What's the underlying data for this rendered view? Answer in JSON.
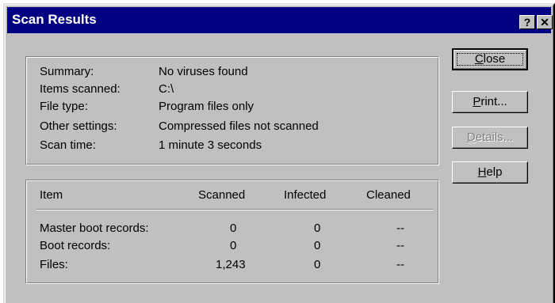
{
  "window": {
    "title": "Scan Results",
    "help_button": "?",
    "close_button": "✕"
  },
  "summary": {
    "rows": [
      {
        "label": "Summary:",
        "value": "No viruses found"
      },
      {
        "label": "Items scanned:",
        "value": "C:\\"
      },
      {
        "label": "File type:",
        "value": "Program files only"
      },
      {
        "label": "Other settings:",
        "value": "Compressed files not scanned"
      },
      {
        "label": "Scan time:",
        "value": "1 minute 3 seconds"
      }
    ]
  },
  "results": {
    "headers": [
      "Item",
      "Scanned",
      "Infected",
      "Cleaned"
    ],
    "rows": [
      [
        "Master boot records:",
        "0",
        "0",
        "--"
      ],
      [
        "Boot records:",
        "0",
        "0",
        "--"
      ],
      [
        "Files:",
        "1,243",
        "0",
        "--"
      ]
    ]
  },
  "buttons": {
    "close": {
      "mnemonic": "C",
      "rest": "lose"
    },
    "print": {
      "mnemonic": "P",
      "rest": "rint..."
    },
    "details": {
      "mnemonic": "D",
      "rest": "etails..."
    },
    "help": {
      "mnemonic": "H",
      "rest": "elp"
    }
  }
}
